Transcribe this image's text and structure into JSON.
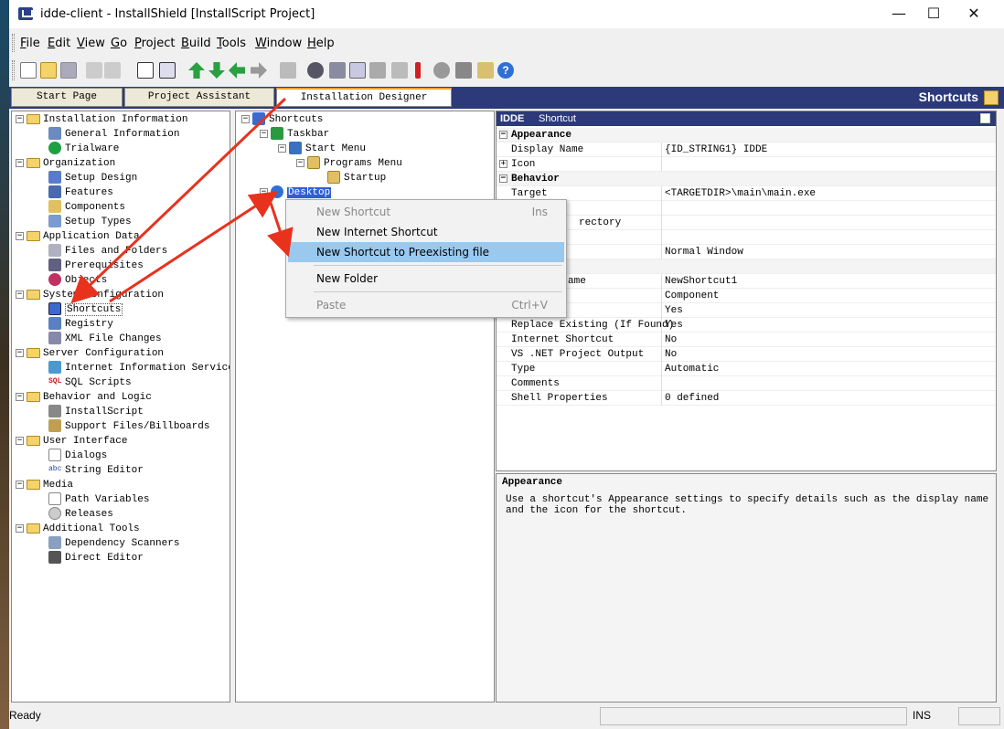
{
  "window": {
    "title": "idde-client - InstallShield [InstallScript Project]",
    "controls": {
      "minimize": "—",
      "maximize": "☐",
      "close": "✕"
    }
  },
  "menubar": [
    {
      "label": "File",
      "u": "F",
      "rest": "ile"
    },
    {
      "label": "Edit",
      "u": "E",
      "rest": "dit"
    },
    {
      "label": "View",
      "u": "V",
      "rest": "iew"
    },
    {
      "label": "Go",
      "u": "G",
      "rest": "o"
    },
    {
      "label": "Project",
      "u": "P",
      "rest": "roject"
    },
    {
      "label": "Build",
      "u": "B",
      "rest": "uild"
    },
    {
      "label": "Tools",
      "u": "T",
      "rest": "ools"
    },
    {
      "label": "Window",
      "u": "W",
      "rest": "indow"
    },
    {
      "label": "Help",
      "u": "H",
      "rest": "elp"
    }
  ],
  "tabs": {
    "start": "Start Page",
    "assistant": "Project Assistant",
    "designer": "Installation Designer",
    "view_title": "Shortcuts"
  },
  "nav_tree": {
    "installation_information": "Installation Information",
    "general_information": "General Information",
    "trialware": "Trialware",
    "organization": "Organization",
    "setup_design": "Setup Design",
    "features": "Features",
    "components": "Components",
    "setup_types": "Setup Types",
    "application_data": "Application Data",
    "files_and_folders": "Files and Folders",
    "prerequisites": "Prerequisites",
    "objects": "Objects",
    "system_configuration": "System Configuration",
    "shortcuts": "Shortcuts",
    "registry": "Registry",
    "xml_file_changes": "XML File Changes",
    "server_configuration": "Server Configuration",
    "iis": "Internet Information Services",
    "sql_scripts": "SQL Scripts",
    "behavior_and_logic": "Behavior and Logic",
    "installscript": "InstallScript",
    "support_files": "Support Files/Billboards",
    "user_interface": "User Interface",
    "dialogs": "Dialogs",
    "string_editor": "String Editor",
    "media": "Media",
    "path_variables": "Path Variables",
    "releases": "Releases",
    "additional_tools": "Additional Tools",
    "dependency_scanners": "Dependency Scanners",
    "direct_editor": "Direct Editor"
  },
  "shortcut_tree": {
    "shortcuts": "Shortcuts",
    "taskbar": "Taskbar",
    "start_menu": "Start Menu",
    "programs_menu": "Programs Menu",
    "startup": "Startup",
    "desktop": "Desktop"
  },
  "context_menu": {
    "new_shortcut": "New Shortcut",
    "new_shortcut_key": "Ins",
    "new_internet_shortcut": "New Internet Shortcut",
    "new_shortcut_preexisting": "New Shortcut to Preexisting file",
    "new_folder": "New Folder",
    "paste": "Paste",
    "paste_key": "Ctrl+V"
  },
  "properties": {
    "header_name": "IDDE",
    "header_type": "Shortcut",
    "cat_appearance": "Appearance",
    "display_name": "Display Name",
    "display_name_val": "{ID_STRING1} IDDE",
    "icon": "Icon",
    "cat_behavior": "Behavior",
    "target": "Target",
    "target_val": "<TARGETDIR>\\main\\main.exe",
    "working_dir_partial": "rectory",
    "run_val": "Normal Window",
    "filename_partial": "ame",
    "filename_val": "NewShortcut1",
    "type_val_component": "Component",
    "yes1": "Yes",
    "replace_existing": "Replace Existing (If Found)",
    "replace_existing_val": "Yes",
    "internet_shortcut": "Internet Shortcut",
    "internet_shortcut_val": "No",
    "vsnet_output": "VS .NET Project Output",
    "vsnet_output_val": "No",
    "type": "Type",
    "type_val": "Automatic",
    "comments": "Comments",
    "shell_properties": "Shell Properties",
    "shell_properties_val": "0 defined"
  },
  "help": {
    "title": "Appearance",
    "text": "Use a shortcut's Appearance settings to specify details such as the display name and the icon for the shortcut."
  },
  "status": {
    "left": "Ready",
    "right": "INS"
  },
  "colors": {
    "accent": "#2c3a7a",
    "annotation": "#e8321e",
    "highlight": "#99c9ef"
  }
}
